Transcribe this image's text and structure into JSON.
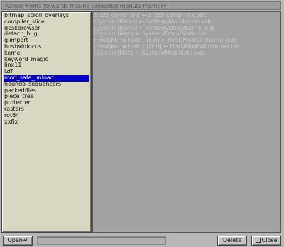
{
  "window": {
    "title": "Kernel works (towards freeing unloaded module memory)"
  },
  "list": {
    "items": [
      "bitmap_scroll_overlays",
      "compiler_slice",
      "deskbrowser",
      "detach_bug",
      "glimport",
      "hostwinfocus",
      "kernel",
      "keyword_magic",
      "linx11",
      "lzff",
      "mod_safe_unload",
      "noundo_sequencers",
      "packedfiles",
      "piece_tree",
      "protected",
      "rasters",
      "rot64",
      "xxfix"
    ],
    "selected_index": 10
  },
  "details": {
    "lines": [
      "z_zzz_comp_link ← z_zzz_comp_link.odc",
      "(System)Kernel ← System/Mod/Kernel.odc",
      "(System)Kernel ← System/Docu/Kernel.odc",
      "(System)Meta ← System/Docu/Meta.odc",
      "(Host)Kernel.odc - [Lin] ← Host/Mod/Lin/Kernel.odc",
      "(Host)Kernel.odc - [Win] ← Host/Mod/Win/Kernel.odc",
      "(System)Meta ← System/Mod/Meta.odc"
    ]
  },
  "toolbar": {
    "open_label_u": "O",
    "open_label_rest": "pen",
    "open_arrow": "↵",
    "delete_label_u": "D",
    "delete_label_rest": "elete",
    "close_label_u": "C",
    "close_label_rest": "lose"
  }
}
